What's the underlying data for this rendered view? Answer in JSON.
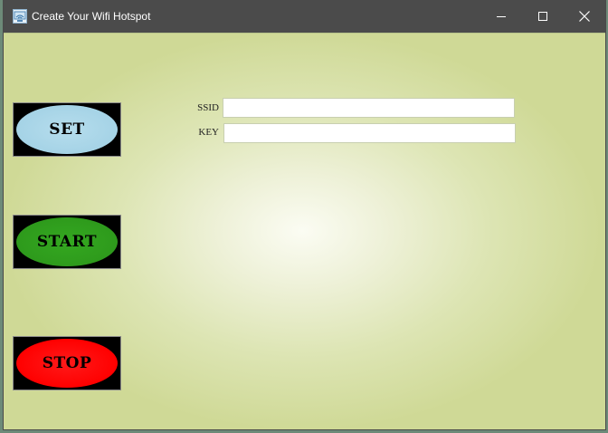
{
  "window": {
    "title": "Create Your Wifi Hotspot",
    "controls": {
      "minimize_icon": "minimize-icon",
      "maximize_icon": "maximize-icon",
      "close_icon": "close-icon"
    }
  },
  "buttons": {
    "set": {
      "label": "SET",
      "color": "#a5d3e6"
    },
    "start": {
      "label": "START",
      "color": "#2e9a1c"
    },
    "stop": {
      "label": "STOP",
      "color": "#ff0000"
    }
  },
  "form": {
    "ssid": {
      "label": "SSID",
      "value": ""
    },
    "key": {
      "label": "KEY",
      "value": ""
    }
  },
  "colors": {
    "titlebar": "#4b4b4b",
    "client_background": "#cfd996"
  }
}
